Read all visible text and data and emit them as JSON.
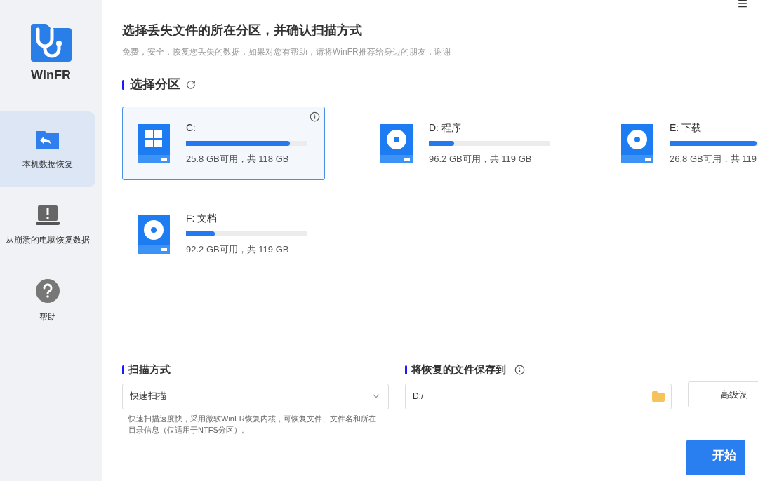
{
  "app": {
    "name": "WinFR"
  },
  "sidebar": {
    "items": [
      {
        "kind": "recover",
        "label": "本机数据恢复",
        "selected": true
      },
      {
        "kind": "crash",
        "label": "从崩溃的电脑恢复数据",
        "selected": false
      },
      {
        "kind": "help",
        "label": "帮助",
        "selected": false
      }
    ]
  },
  "header": {
    "title": "选择丢失文件的所在分区，并确认扫描方式",
    "subtitle": "免费，安全，恢复您丢失的数据，如果对您有帮助，请将WinFR推荐给身边的朋友，谢谢"
  },
  "partitions_section": {
    "title": "选择分区"
  },
  "partitions": [
    {
      "kind": "system",
      "name": "C:",
      "level": 0.86,
      "usage": "25.8 GB可用，共 118 GB",
      "selected": true
    },
    {
      "kind": "disk",
      "name": "D: 程序",
      "level": 0.21,
      "usage": "96.2 GB可用，共 119 GB",
      "selected": false
    },
    {
      "kind": "disk",
      "name": "E: 下载",
      "level": 0.72,
      "usage": "26.8 GB可用，共 119",
      "selected": false
    },
    {
      "kind": "disk",
      "name": "F: 文档",
      "level": 0.24,
      "usage": "92.2 GB可用，共 119 GB",
      "selected": false
    }
  ],
  "scan_mode": {
    "title": "扫描方式",
    "value": "快速扫描",
    "description": "快速扫描速度快，采用微软WinFR恢复内核，可恢复文件、文件名和所在目录信息（仅适用于NTFS分区）。"
  },
  "save_to": {
    "title": "将恢复的文件保存到",
    "value": "D:/"
  },
  "advanced_button": "高级设",
  "start_button": "开始"
}
